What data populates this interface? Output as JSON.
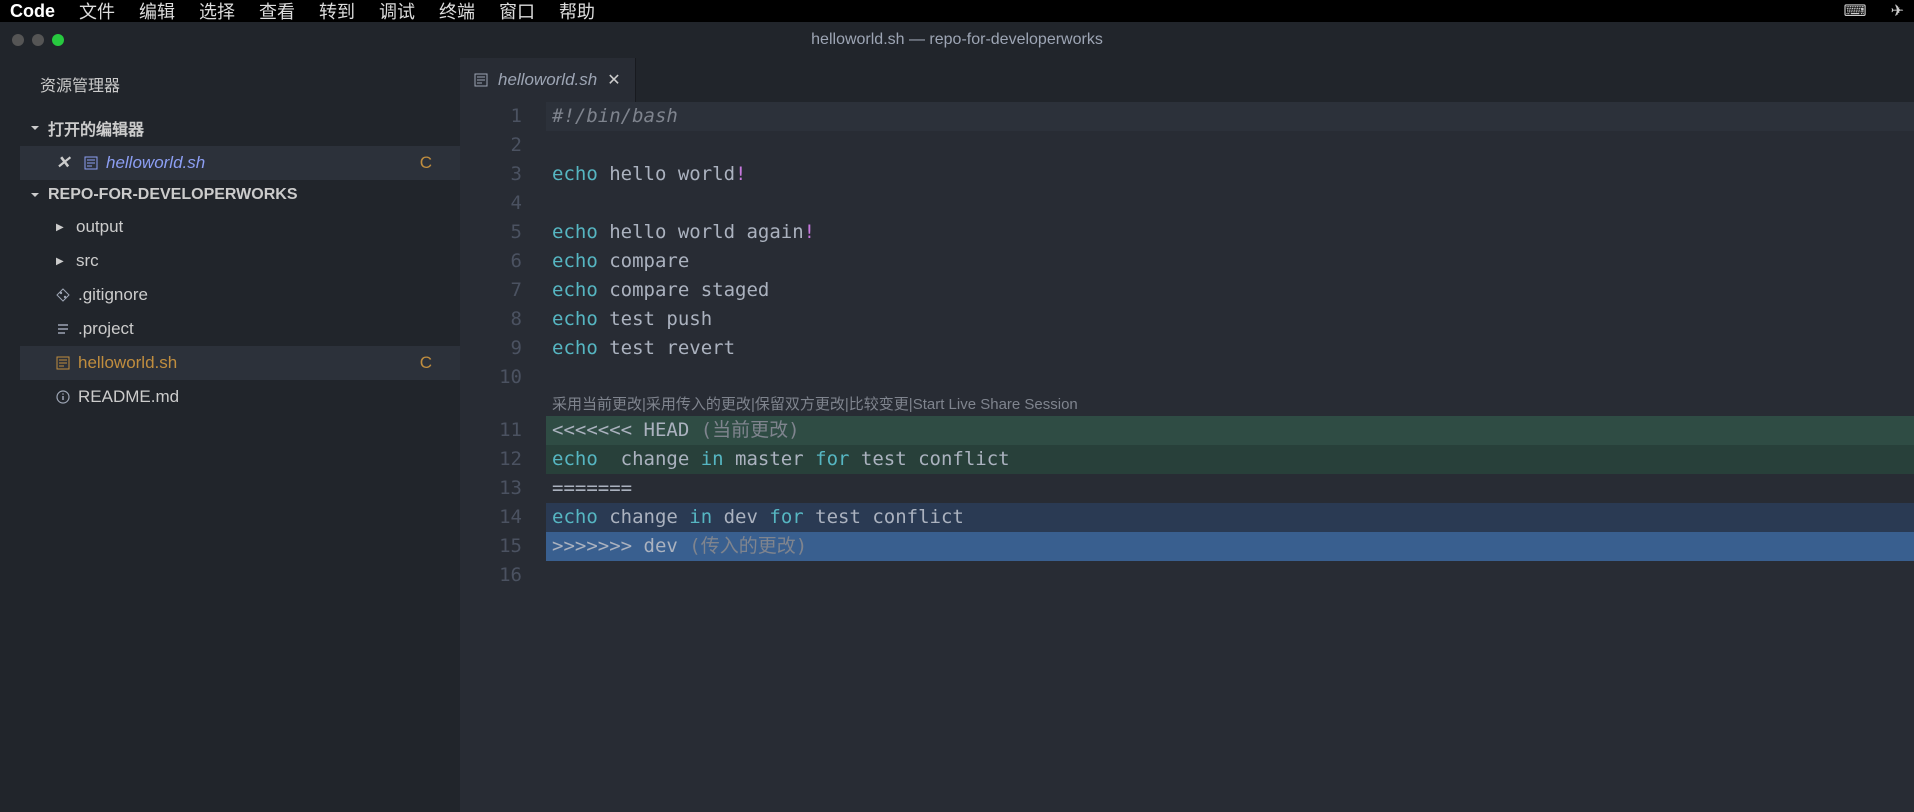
{
  "menubar": {
    "brand": "Code",
    "items": [
      "文件",
      "编辑",
      "选择",
      "查看",
      "转到",
      "调试",
      "终端",
      "窗口",
      "帮助"
    ]
  },
  "titlebar": {
    "title": "helloworld.sh — repo-for-developerworks"
  },
  "sidebar": {
    "title": "资源管理器",
    "open_editors_label": "打开的编辑器",
    "repo_label": "REPO-FOR-DEVELOPERWORKS",
    "open_editors": [
      {
        "name": "helloworld.sh",
        "status": "C",
        "modified": true
      }
    ],
    "tree": [
      {
        "type": "folder",
        "name": "output"
      },
      {
        "type": "folder",
        "name": "src"
      },
      {
        "type": "file",
        "name": ".gitignore",
        "icon": "git"
      },
      {
        "type": "file",
        "name": ".project",
        "icon": "lines"
      },
      {
        "type": "file",
        "name": "helloworld.sh",
        "icon": "file",
        "status": "C",
        "active": true
      },
      {
        "type": "file",
        "name": "README.md",
        "icon": "info"
      }
    ]
  },
  "tabs": [
    {
      "name": "helloworld.sh",
      "modified": true
    }
  ],
  "codelens": {
    "items": [
      "采用当前更改",
      "采用传入的更改",
      "保留双方更改",
      "比较变更",
      "Start Live Share Session"
    ]
  },
  "code": {
    "lines": [
      {
        "n": 1,
        "kind": "comment",
        "text": "#!/bin/bash",
        "current": true
      },
      {
        "n": 2,
        "kind": "blank",
        "text": ""
      },
      {
        "n": 3,
        "kind": "echo",
        "kw": "echo",
        "body": " hello world",
        "punc": "!"
      },
      {
        "n": 4,
        "kind": "blank",
        "text": ""
      },
      {
        "n": 5,
        "kind": "echo",
        "kw": "echo",
        "body": " hello world again",
        "punc": "!"
      },
      {
        "n": 6,
        "kind": "echo",
        "kw": "echo",
        "body": " compare"
      },
      {
        "n": 7,
        "kind": "echo",
        "kw": "echo",
        "body": " compare staged"
      },
      {
        "n": 8,
        "kind": "echo",
        "kw": "echo",
        "body": " test push"
      },
      {
        "n": 9,
        "kind": "echo",
        "kw": "echo",
        "body": " test revert"
      },
      {
        "n": 10,
        "kind": "blank",
        "text": ""
      },
      {
        "n": 11,
        "kind": "conflict-head",
        "marker": "<<<<<<< HEAD",
        "annot": " (当前更改)"
      },
      {
        "n": 12,
        "kind": "conflict-ours",
        "kw": "echo",
        "body1": "  change ",
        "kw2": "in",
        "body2": " master ",
        "kw3": "for",
        "body3": " test conflict"
      },
      {
        "n": 13,
        "kind": "conflict-sep",
        "marker": "======="
      },
      {
        "n": 14,
        "kind": "conflict-theirs",
        "kw": "echo",
        "body1": " change ",
        "kw2": "in",
        "body2": " dev ",
        "kw3": "for",
        "body3": " test conflict"
      },
      {
        "n": 15,
        "kind": "conflict-end",
        "marker": ">>>>>>> dev",
        "annot": " (传入的更改)"
      },
      {
        "n": 16,
        "kind": "blank",
        "text": ""
      }
    ]
  }
}
